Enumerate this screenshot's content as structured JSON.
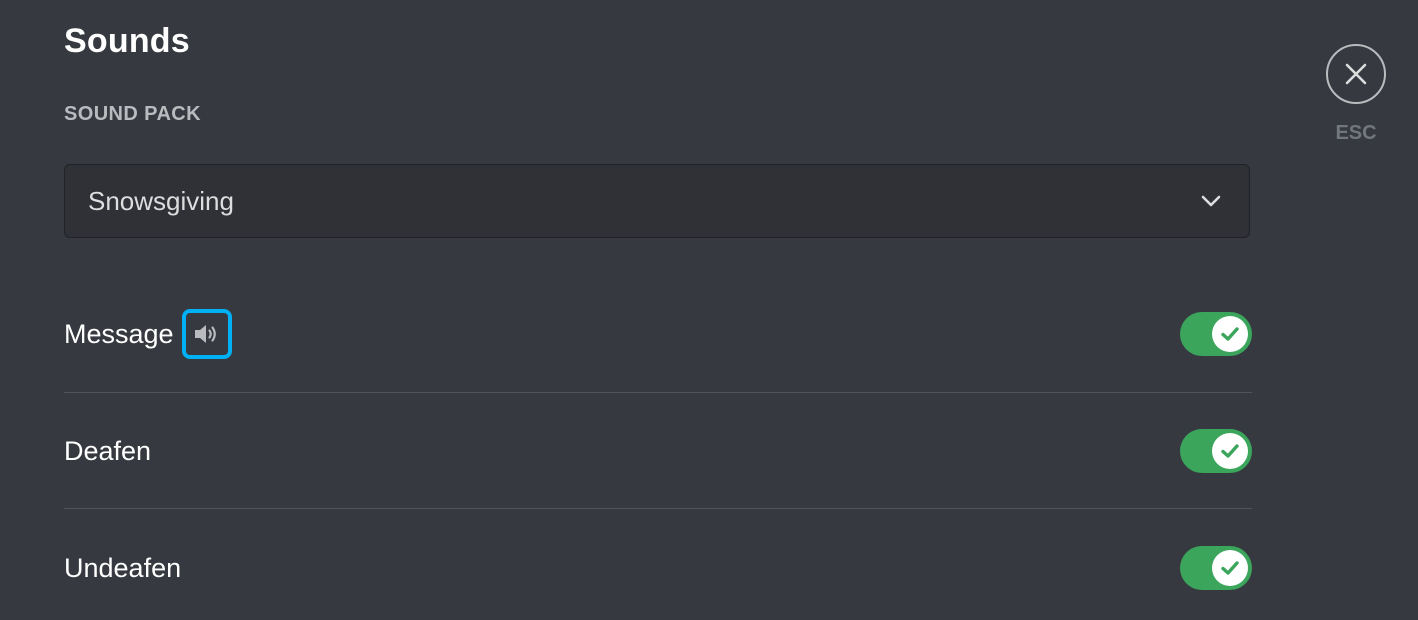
{
  "header": {
    "title": "Sounds"
  },
  "sound_pack": {
    "label": "SOUND PACK",
    "selected": "Snowsgiving"
  },
  "rows": [
    {
      "label": "Message",
      "enabled": true,
      "has_preview": true
    },
    {
      "label": "Deafen",
      "enabled": true,
      "has_preview": false
    },
    {
      "label": "Undeafen",
      "enabled": true,
      "has_preview": false
    }
  ],
  "close": {
    "label": "ESC"
  },
  "icons": {
    "close": "close-icon",
    "chevron": "chevron-down-icon",
    "speaker": "speaker-icon",
    "check": "check-icon"
  },
  "colors": {
    "background": "#36393f",
    "toggle_on": "#3ba55c",
    "focus_ring": "#00b0f4"
  }
}
